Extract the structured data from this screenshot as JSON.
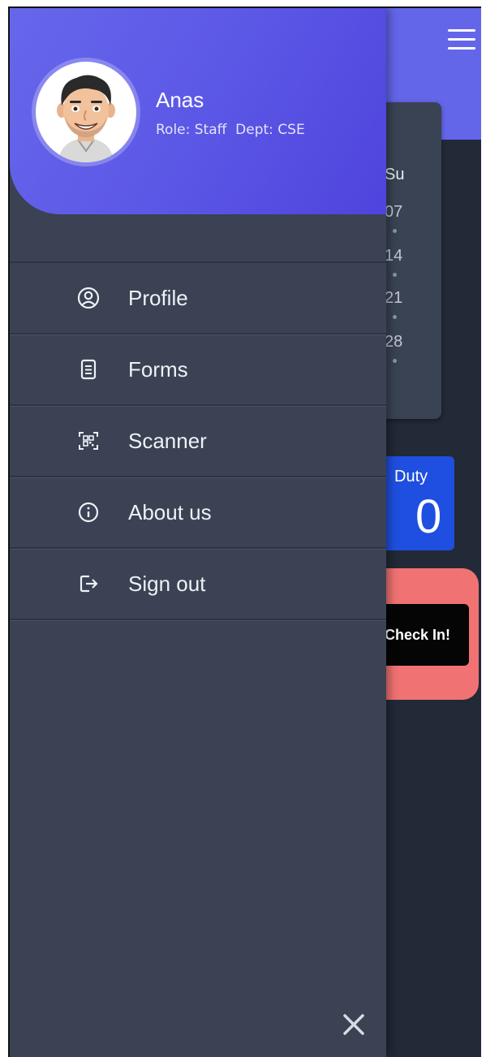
{
  "background": {
    "calendar": {
      "day_header": "Su",
      "dates": [
        "07",
        "14",
        "21",
        "28"
      ]
    },
    "duty": {
      "label": "Duty",
      "value": "0"
    },
    "checkin": {
      "label": "Check In!"
    }
  },
  "drawer": {
    "user": {
      "name": "Anas",
      "role": "Role: Staff",
      "dept": "Dept: CSE"
    },
    "menu": [
      {
        "label": "Profile",
        "icon": "user-circle-icon"
      },
      {
        "label": "Forms",
        "icon": "document-icon"
      },
      {
        "label": "Scanner",
        "icon": "qr-scan-icon"
      },
      {
        "label": "About us",
        "icon": "info-icon"
      },
      {
        "label": "Sign out",
        "icon": "sign-out-icon"
      }
    ]
  },
  "colors": {
    "header_gradient_start": "#6667ec",
    "header_gradient_end": "#4f43dd",
    "drawer_bg": "#3a4253",
    "page_bg": "#222937",
    "duty_card": "#1f4fe0",
    "checkin_card": "#f07272"
  }
}
